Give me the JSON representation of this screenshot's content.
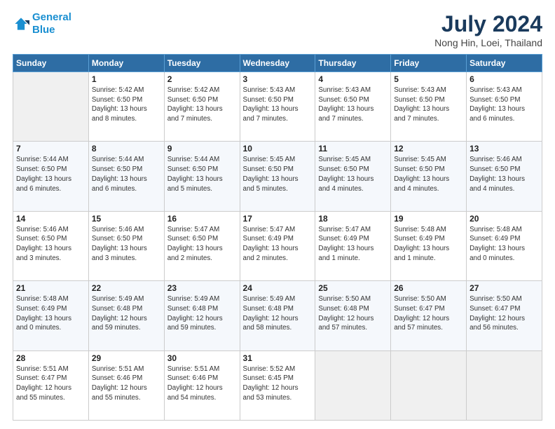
{
  "logo": {
    "line1": "General",
    "line2": "Blue"
  },
  "title": "July 2024",
  "location": "Nong Hin, Loei, Thailand",
  "days_of_week": [
    "Sunday",
    "Monday",
    "Tuesday",
    "Wednesday",
    "Thursday",
    "Friday",
    "Saturday"
  ],
  "weeks": [
    [
      {
        "day": "",
        "info": ""
      },
      {
        "day": "1",
        "info": "Sunrise: 5:42 AM\nSunset: 6:50 PM\nDaylight: 13 hours\nand 8 minutes."
      },
      {
        "day": "2",
        "info": "Sunrise: 5:42 AM\nSunset: 6:50 PM\nDaylight: 13 hours\nand 7 minutes."
      },
      {
        "day": "3",
        "info": "Sunrise: 5:43 AM\nSunset: 6:50 PM\nDaylight: 13 hours\nand 7 minutes."
      },
      {
        "day": "4",
        "info": "Sunrise: 5:43 AM\nSunset: 6:50 PM\nDaylight: 13 hours\nand 7 minutes."
      },
      {
        "day": "5",
        "info": "Sunrise: 5:43 AM\nSunset: 6:50 PM\nDaylight: 13 hours\nand 7 minutes."
      },
      {
        "day": "6",
        "info": "Sunrise: 5:43 AM\nSunset: 6:50 PM\nDaylight: 13 hours\nand 6 minutes."
      }
    ],
    [
      {
        "day": "7",
        "info": "Sunrise: 5:44 AM\nSunset: 6:50 PM\nDaylight: 13 hours\nand 6 minutes."
      },
      {
        "day": "8",
        "info": "Sunrise: 5:44 AM\nSunset: 6:50 PM\nDaylight: 13 hours\nand 6 minutes."
      },
      {
        "day": "9",
        "info": "Sunrise: 5:44 AM\nSunset: 6:50 PM\nDaylight: 13 hours\nand 5 minutes."
      },
      {
        "day": "10",
        "info": "Sunrise: 5:45 AM\nSunset: 6:50 PM\nDaylight: 13 hours\nand 5 minutes."
      },
      {
        "day": "11",
        "info": "Sunrise: 5:45 AM\nSunset: 6:50 PM\nDaylight: 13 hours\nand 4 minutes."
      },
      {
        "day": "12",
        "info": "Sunrise: 5:45 AM\nSunset: 6:50 PM\nDaylight: 13 hours\nand 4 minutes."
      },
      {
        "day": "13",
        "info": "Sunrise: 5:46 AM\nSunset: 6:50 PM\nDaylight: 13 hours\nand 4 minutes."
      }
    ],
    [
      {
        "day": "14",
        "info": "Sunrise: 5:46 AM\nSunset: 6:50 PM\nDaylight: 13 hours\nand 3 minutes."
      },
      {
        "day": "15",
        "info": "Sunrise: 5:46 AM\nSunset: 6:50 PM\nDaylight: 13 hours\nand 3 minutes."
      },
      {
        "day": "16",
        "info": "Sunrise: 5:47 AM\nSunset: 6:50 PM\nDaylight: 13 hours\nand 2 minutes."
      },
      {
        "day": "17",
        "info": "Sunrise: 5:47 AM\nSunset: 6:49 PM\nDaylight: 13 hours\nand 2 minutes."
      },
      {
        "day": "18",
        "info": "Sunrise: 5:47 AM\nSunset: 6:49 PM\nDaylight: 13 hours\nand 1 minute."
      },
      {
        "day": "19",
        "info": "Sunrise: 5:48 AM\nSunset: 6:49 PM\nDaylight: 13 hours\nand 1 minute."
      },
      {
        "day": "20",
        "info": "Sunrise: 5:48 AM\nSunset: 6:49 PM\nDaylight: 13 hours\nand 0 minutes."
      }
    ],
    [
      {
        "day": "21",
        "info": "Sunrise: 5:48 AM\nSunset: 6:49 PM\nDaylight: 13 hours\nand 0 minutes."
      },
      {
        "day": "22",
        "info": "Sunrise: 5:49 AM\nSunset: 6:48 PM\nDaylight: 12 hours\nand 59 minutes."
      },
      {
        "day": "23",
        "info": "Sunrise: 5:49 AM\nSunset: 6:48 PM\nDaylight: 12 hours\nand 59 minutes."
      },
      {
        "day": "24",
        "info": "Sunrise: 5:49 AM\nSunset: 6:48 PM\nDaylight: 12 hours\nand 58 minutes."
      },
      {
        "day": "25",
        "info": "Sunrise: 5:50 AM\nSunset: 6:48 PM\nDaylight: 12 hours\nand 57 minutes."
      },
      {
        "day": "26",
        "info": "Sunrise: 5:50 AM\nSunset: 6:47 PM\nDaylight: 12 hours\nand 57 minutes."
      },
      {
        "day": "27",
        "info": "Sunrise: 5:50 AM\nSunset: 6:47 PM\nDaylight: 12 hours\nand 56 minutes."
      }
    ],
    [
      {
        "day": "28",
        "info": "Sunrise: 5:51 AM\nSunset: 6:47 PM\nDaylight: 12 hours\nand 55 minutes."
      },
      {
        "day": "29",
        "info": "Sunrise: 5:51 AM\nSunset: 6:46 PM\nDaylight: 12 hours\nand 55 minutes."
      },
      {
        "day": "30",
        "info": "Sunrise: 5:51 AM\nSunset: 6:46 PM\nDaylight: 12 hours\nand 54 minutes."
      },
      {
        "day": "31",
        "info": "Sunrise: 5:52 AM\nSunset: 6:45 PM\nDaylight: 12 hours\nand 53 minutes."
      },
      {
        "day": "",
        "info": ""
      },
      {
        "day": "",
        "info": ""
      },
      {
        "day": "",
        "info": ""
      }
    ]
  ]
}
